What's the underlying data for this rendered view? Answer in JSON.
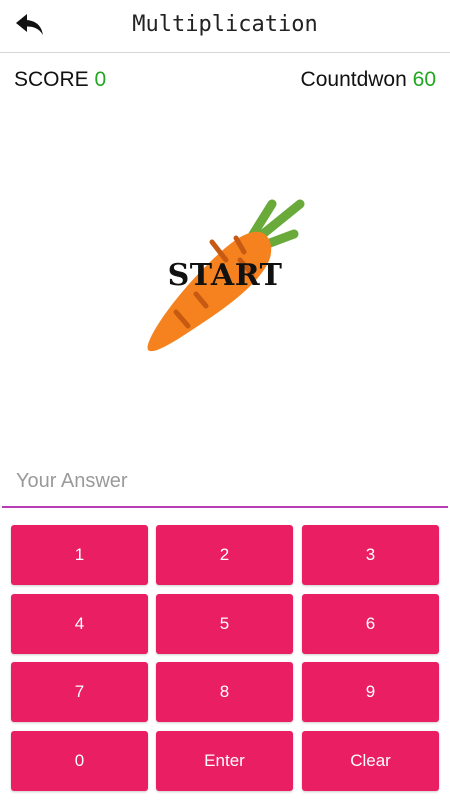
{
  "app": {
    "title": "Multiplication"
  },
  "status": {
    "score_label": "SCORE",
    "score_value": "0",
    "countdown_label": "Countdwon",
    "countdown_value": "60"
  },
  "game": {
    "start_label": "START",
    "image": "carrot"
  },
  "answer": {
    "placeholder": "Your Answer",
    "value": ""
  },
  "keypad": {
    "key_1": "1",
    "key_2": "2",
    "key_3": "3",
    "key_4": "4",
    "key_5": "5",
    "key_6": "6",
    "key_7": "7",
    "key_8": "8",
    "key_9": "9",
    "key_0": "0",
    "enter": "Enter",
    "clear": "Clear"
  },
  "icons": {
    "back": "arrow-back-icon"
  },
  "colors": {
    "key_background": "#e91e63",
    "key_text": "#ffffff",
    "number_green": "#23a623",
    "input_underline": "#b93bb5",
    "carrot_body": "#f5821f",
    "carrot_leaves": "#6aaa3a"
  }
}
